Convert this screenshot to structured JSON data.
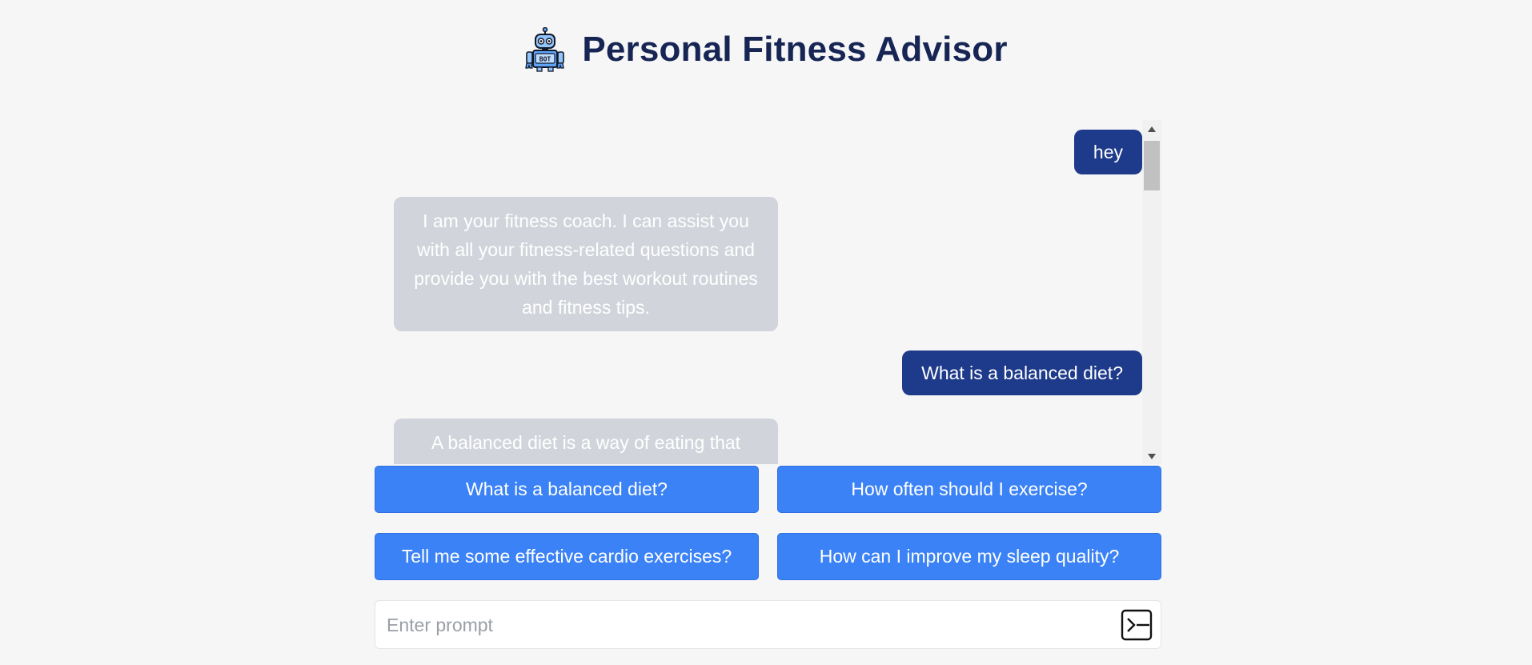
{
  "app": {
    "title": "Personal Fitness Advisor",
    "logo_text": "BOT"
  },
  "messages": [
    {
      "role": "user",
      "text": "hey"
    },
    {
      "role": "bot",
      "text": "I am your fitness coach. I can assist you with all your fitness-related questions and provide you with the best workout routines and fitness tips."
    },
    {
      "role": "user",
      "text": "What is a balanced diet?"
    },
    {
      "role": "bot",
      "text": "A balanced diet is a way of eating that provides your body with all the nutrients it needs to function properly."
    }
  ],
  "suggestions": [
    {
      "label": "What is a balanced diet?"
    },
    {
      "label": "How often should I exercise?"
    },
    {
      "label": "Tell me some effective cardio exercises?"
    },
    {
      "label": "How can I improve my sleep quality?"
    }
  ],
  "input": {
    "placeholder": "Enter prompt",
    "value": ""
  },
  "icons": {
    "logo": "robot-bot-icon",
    "send": "terminal-send-icon"
  },
  "colors": {
    "title": "#172554",
    "user_bubble": "#1e3a8a",
    "bot_bubble": "#d1d5db",
    "suggestion": "#3b82f6",
    "background": "#f6f6f7"
  }
}
